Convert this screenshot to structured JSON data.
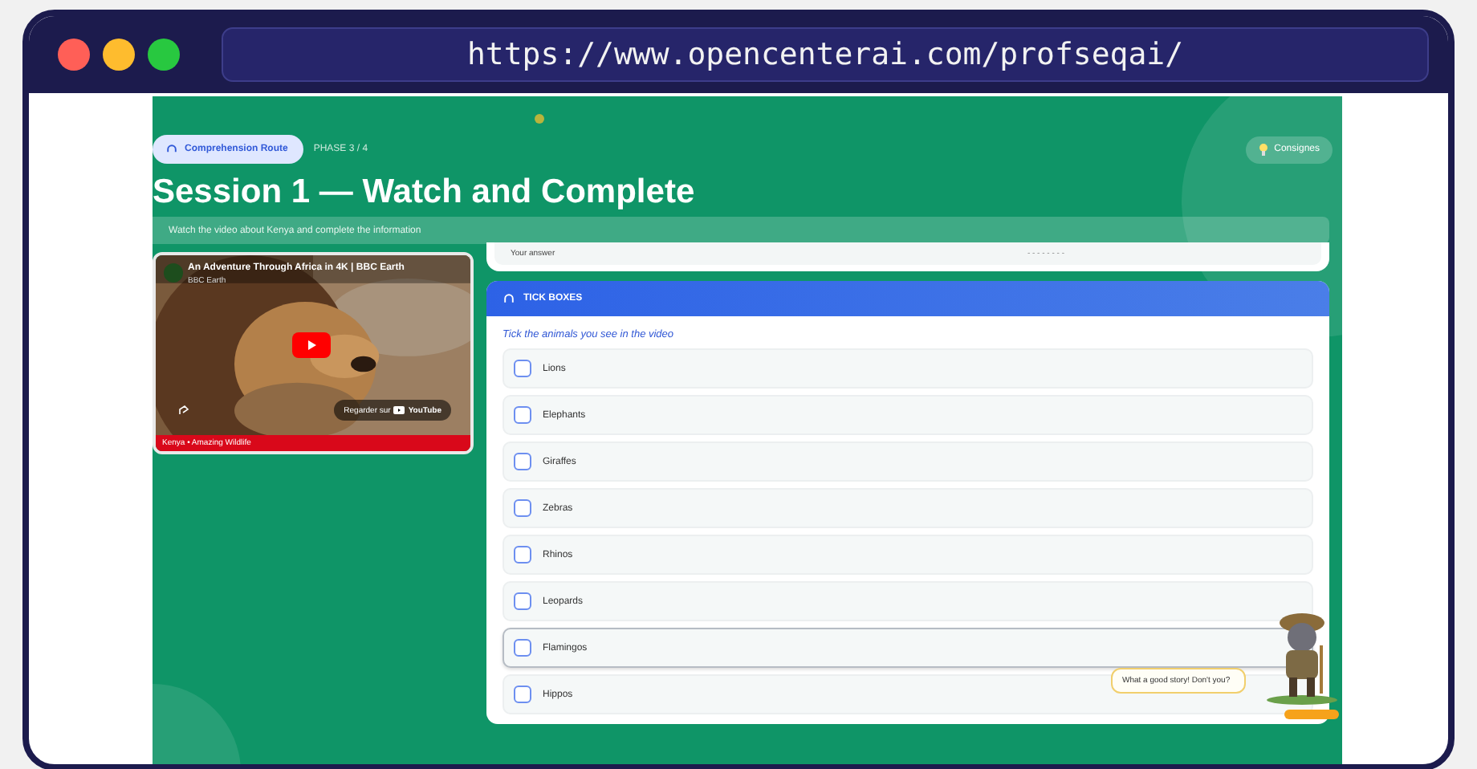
{
  "browser": {
    "url": "https://www.opencenterai.com/profseqai/"
  },
  "header": {
    "badge": "Comprehension Route",
    "phase": "PHASE 3 / 4",
    "help_button": "Consignes"
  },
  "title": "Session 1 — Watch and Complete",
  "subtitle": "Watch the video about Kenya and complete the information",
  "video": {
    "title": "An Adventure Through Africa in 4K | BBC Earth",
    "channel": "BBC Earth",
    "watch_button": "Regarder sur",
    "watch_brand": "YouTube",
    "caption": "Kenya • Amazing Wildlife"
  },
  "previous_card": {
    "label": "Your answer",
    "value": "- - - - - - - -"
  },
  "tick_boxes": {
    "heading": "TICK BOXES",
    "instruction": "Tick the animals you see in the video",
    "items": [
      {
        "label": "Lions",
        "checked": false,
        "highlighted": false
      },
      {
        "label": "Elephants",
        "checked": false,
        "highlighted": false
      },
      {
        "label": "Giraffes",
        "checked": false,
        "highlighted": false
      },
      {
        "label": "Zebras",
        "checked": false,
        "highlighted": false
      },
      {
        "label": "Rhinos",
        "checked": false,
        "highlighted": false
      },
      {
        "label": "Leopards",
        "checked": false,
        "highlighted": false
      },
      {
        "label": "Flamingos",
        "checked": false,
        "highlighted": true
      },
      {
        "label": "Hippos",
        "checked": false,
        "highlighted": false
      }
    ]
  },
  "mascot": {
    "speech": "What a good story! Don't you?"
  }
}
